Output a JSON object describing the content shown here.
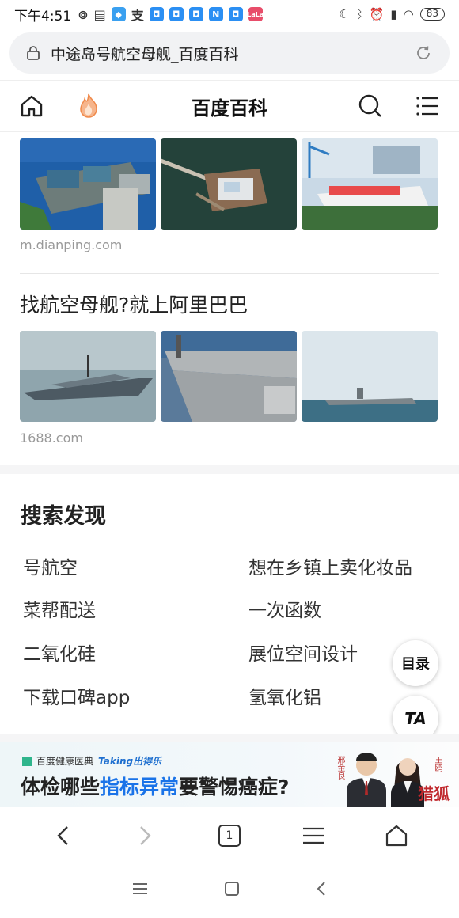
{
  "status_bar": {
    "time": "下午4:51",
    "battery": "83",
    "app_badges": [
      "N"
    ],
    "lala_badge": "LaLa"
  },
  "url_bar": {
    "title": "中途岛号航空母舰_百度百科"
  },
  "site_header": {
    "title": "百度百科"
  },
  "results": [
    {
      "source": "m.dianping.com"
    },
    {
      "title": "找航空母舰?就上阿里巴巴",
      "source": "1688.com"
    }
  ],
  "discover": {
    "title": "搜索发现",
    "items": [
      "号航空",
      "想在乡镇上卖化妆品",
      "菜帮配送",
      "一次函数",
      "二氧化硅",
      "展位空间设计",
      "下载口碑app",
      "氢氧化铝"
    ]
  },
  "float_buttons": {
    "toc": "目录",
    "ta": "TA"
  },
  "ad": {
    "brand": "百度健康医典",
    "brand_tag": "Taking出得乐",
    "headline_pre": "体检哪些",
    "headline_highlight": "指标异常",
    "headline_post": "要警惕癌症?",
    "person1_name": "邢金良",
    "person2_name": "王鸥",
    "logo_text": "猎狐"
  },
  "toolbar": {
    "tab_count": "1"
  },
  "colors": {
    "accent_blue": "#1a73e8",
    "fire_orange": "#f08a4b",
    "text_dark": "#222222"
  }
}
